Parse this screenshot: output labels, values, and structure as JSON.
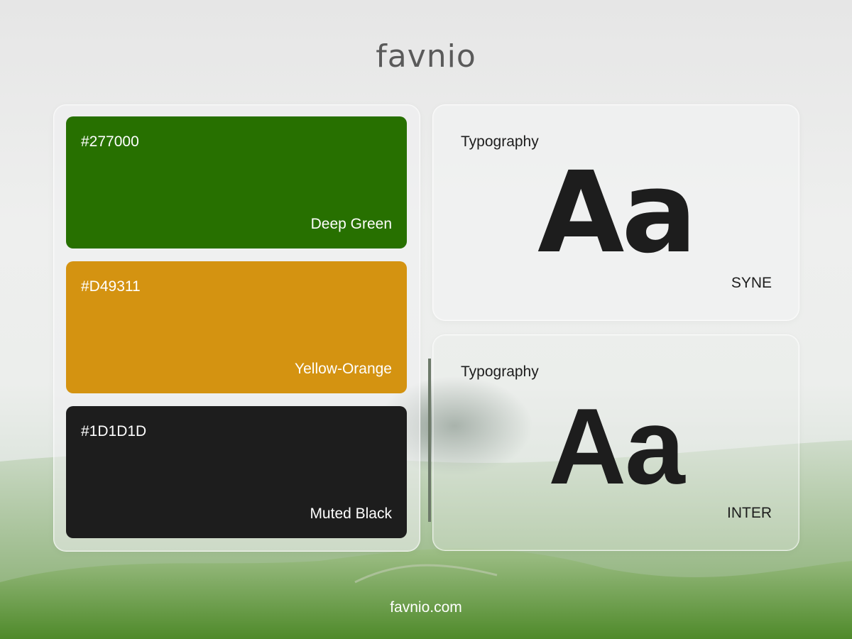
{
  "brand": {
    "logo_text": "favnio",
    "footer": "favnio.com"
  },
  "colors": [
    {
      "hex_label": "#277000",
      "name": "Deep Green",
      "color": "#277000"
    },
    {
      "hex_label": "#D49311",
      "name": "Yellow-Orange",
      "color": "#D49311"
    },
    {
      "hex_label": "#1D1D1D",
      "name": "Muted Black",
      "color": "#1D1D1D"
    }
  ],
  "typography": [
    {
      "label": "Typography",
      "sample": "Aa",
      "font_name": "SYNE"
    },
    {
      "label": "Typography",
      "sample": "Aa",
      "font_name": "INTER"
    }
  ]
}
